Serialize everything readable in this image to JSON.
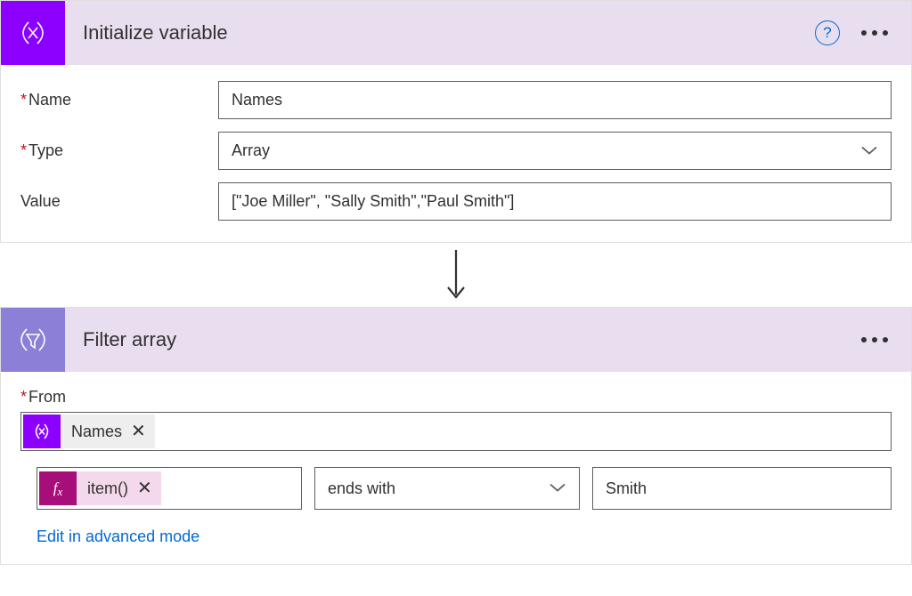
{
  "card1": {
    "title": "Initialize variable",
    "name_label": "Name",
    "name_value": "Names",
    "type_label": "Type",
    "type_value": "Array",
    "value_label": "Value",
    "value_value": "[\"Joe Miller\", \"Sally Smith\",\"Paul Smith\"]"
  },
  "card2": {
    "title": "Filter array",
    "from_label": "From",
    "from_token": "Names",
    "item_token": "item()",
    "operator": "ends with",
    "compare_value": "Smith",
    "advanced_link": "Edit in advanced mode"
  },
  "help_tooltip": "?"
}
